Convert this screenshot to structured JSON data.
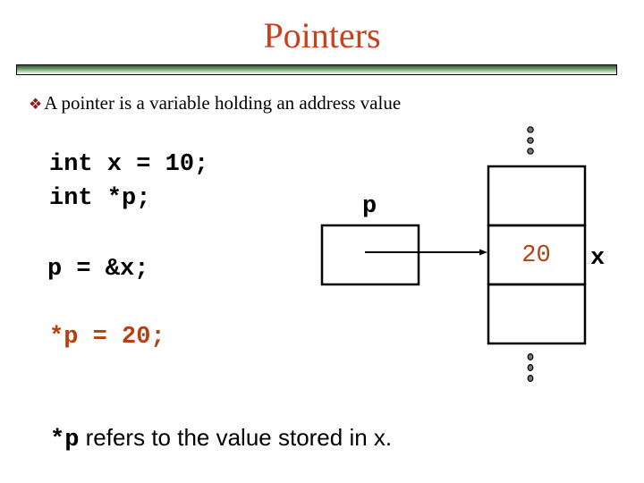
{
  "slide": {
    "title": "Pointers",
    "bullet": {
      "icon": "diamond-bullet-icon",
      "glyph": "❖",
      "text": "A pointer is a variable holding an address value"
    },
    "code_lines": [
      "int x = 10;",
      "int *p;",
      "p = &x;",
      "*p = 20;"
    ],
    "diagram": {
      "pointer_label": "p",
      "variable_label": "x",
      "memory_cell_value": "20",
      "ellipsis_icon": "vertical-ellipsis-icon"
    },
    "note": {
      "code": "*p",
      "text": " refers to the value stored in x."
    },
    "colors": {
      "title": "#c8401c",
      "highlight": "#b8400f",
      "bullet": "#8b1a1a",
      "bar_dark": "#2c5a2a"
    }
  }
}
